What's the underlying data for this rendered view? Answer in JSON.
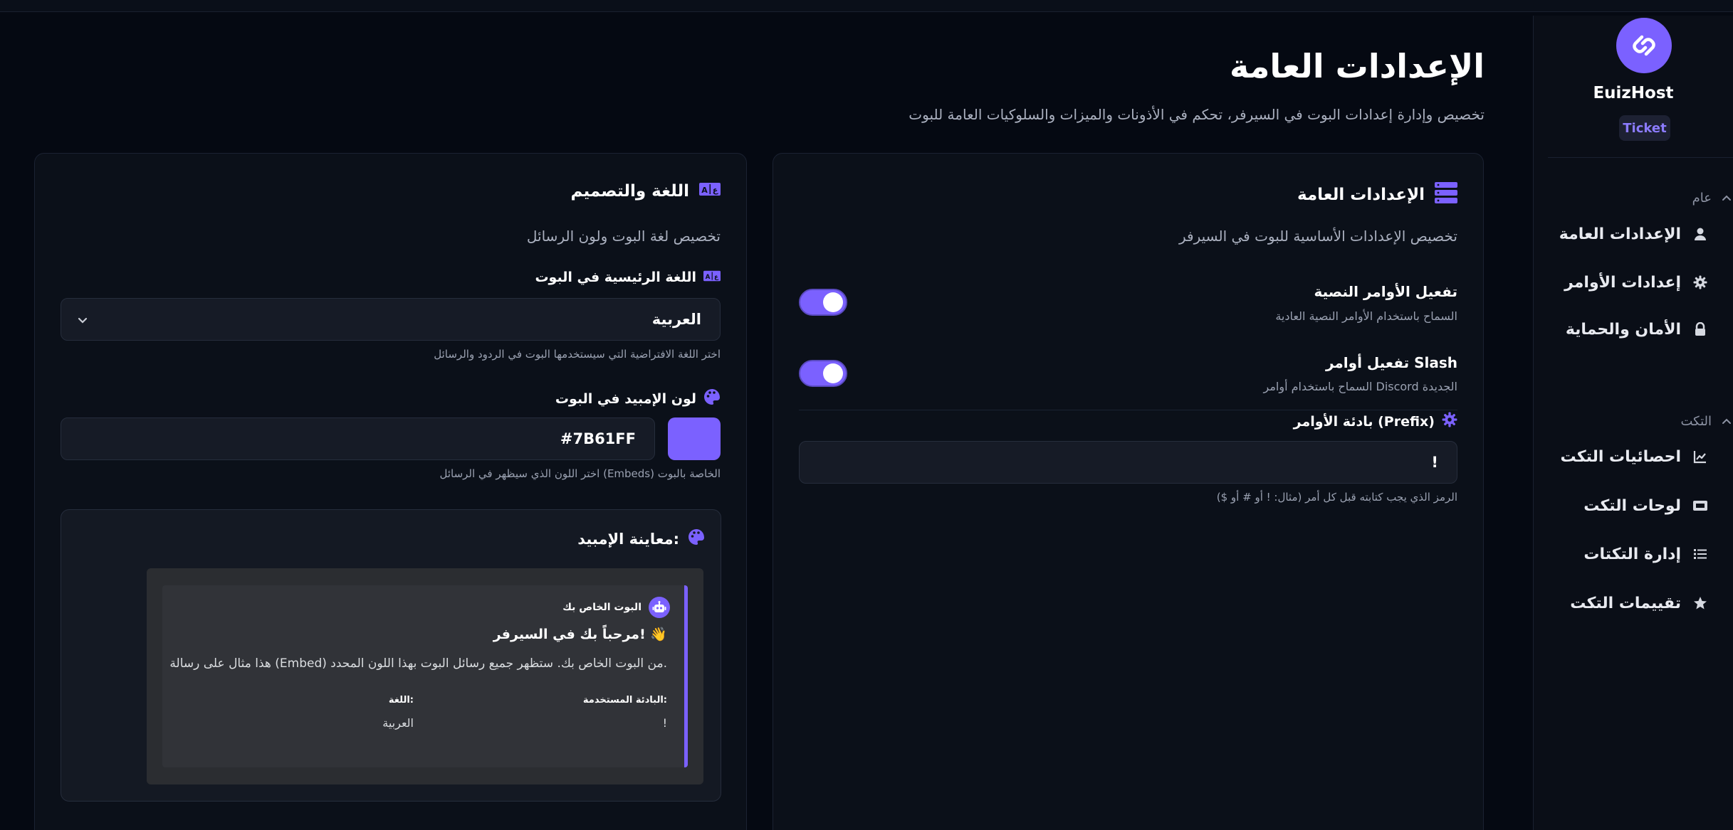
{
  "sidebar": {
    "brand_name": "EuizHost",
    "brand_badge": "Ticket",
    "sections": [
      {
        "title": "عام",
        "items": [
          {
            "label": "الإعدادات العامة",
            "icon": "user-icon"
          },
          {
            "label": "إعدادات الأوامر",
            "icon": "gear-icon"
          },
          {
            "label": "الأمان والحماية",
            "icon": "lock-icon"
          }
        ]
      },
      {
        "title": "التكت",
        "items": [
          {
            "label": "احصائيات التكت",
            "icon": "chart-icon"
          },
          {
            "label": "لوحات التكت",
            "icon": "ticket-icon"
          },
          {
            "label": "إدارة التكتات",
            "icon": "list-icon"
          },
          {
            "label": "تقييمات التكت",
            "icon": "star-icon"
          }
        ]
      }
    ]
  },
  "page": {
    "title": "الإعدادات العامة",
    "subtitle": "تخصيص وإدارة إعدادات البوت في السيرفر، تحكم في الأذونات والميزات والسلوكيات العامة للبوت"
  },
  "general_card": {
    "title": "الإعدادات العامة",
    "description": "تخصيص الإعدادات الأساسية للبوت في السيرفر",
    "text_commands": {
      "title": "تفعيل الأوامر النصية",
      "description": "السماح باستخدام الأوامر النصية العادية",
      "enabled": true
    },
    "slash_commands": {
      "title": "تفعيل أوامر Slash",
      "description": "السماح باستخدام أوامر Discord الجديدة",
      "enabled": true
    },
    "prefix": {
      "label": "بادئة الأوامر (Prefix)",
      "value": "!",
      "hint": "الرمز الذي يجب كتابته قبل كل أمر (مثال: ! أو # أو $)"
    }
  },
  "language_card": {
    "title": "اللغة والتصميم",
    "description": "تخصيص لغة البوت ولون الرسائل",
    "language": {
      "label": "اللغة الرئيسية في البوت",
      "value": "العربية",
      "hint": "اختر اللغة الافتراضية التي سيستخدمها البوت في الردود والرسائل"
    },
    "embed_color": {
      "label": "لون الإمبيد في البوت",
      "value": "#7B61FF",
      "hint": "اختر اللون الذي سيظهر في الرسائل (Embeds) الخاصة بالبوت"
    },
    "preview": {
      "title": "معاينة الإمبيد:",
      "author": "البوت الخاص بك",
      "embed_title": "مرحباً بك في السيرفر! 👋",
      "embed_description": "هذا مثال على رسالة (Embed) من البوت الخاص بك. ستظهر جميع رسائل البوت بهذا اللون المحدد.",
      "fields": [
        {
          "name": "البادئة المستخدمة:",
          "value": "!"
        },
        {
          "name": "اللغة:",
          "value": "العربية"
        }
      ]
    }
  },
  "colors": {
    "accent": "#7B61FF",
    "background": "#050912",
    "card": "#0B1019"
  }
}
